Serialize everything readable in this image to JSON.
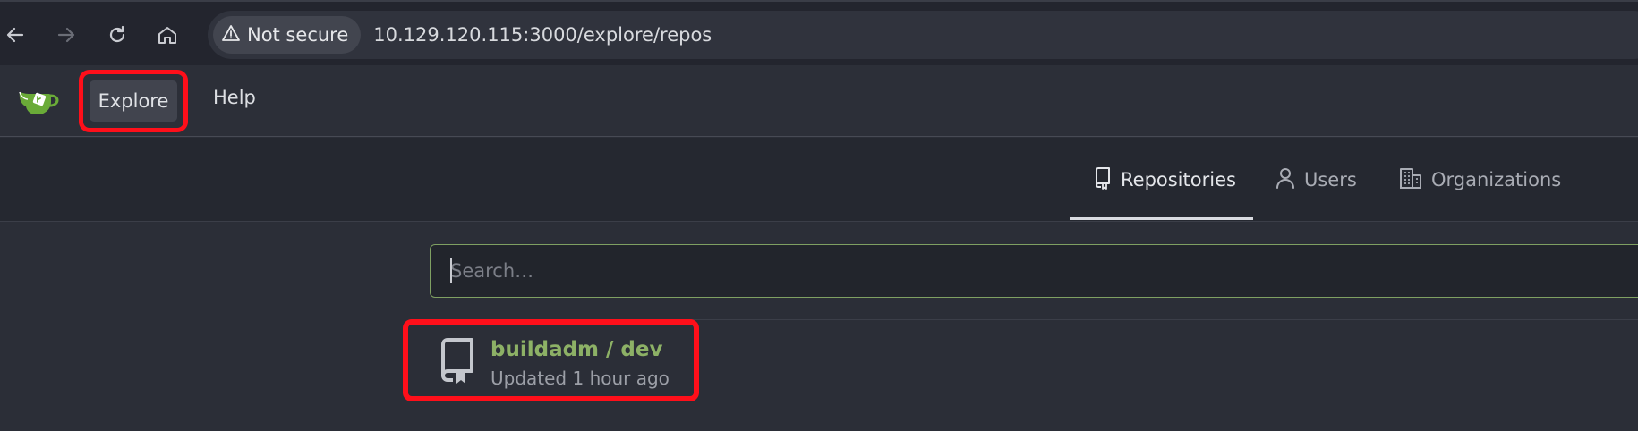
{
  "browser": {
    "security_label": "Not secure",
    "url": "10.129.120.115:3000/explore/repos"
  },
  "nav": {
    "explore_label": "Explore",
    "help_label": "Help"
  },
  "tabs": [
    {
      "label": "Repositories",
      "icon": "repo-icon",
      "active": true
    },
    {
      "label": "Users",
      "icon": "person-icon",
      "active": false
    },
    {
      "label": "Organizations",
      "icon": "organization-icon",
      "active": false
    }
  ],
  "search": {
    "placeholder": "Search…",
    "value": ""
  },
  "repos": [
    {
      "name": "buildadm / dev",
      "updated": "Updated 1 hour ago"
    }
  ],
  "colors": {
    "accent_green": "#8db166",
    "highlight_red": "#ff0f1a",
    "background": "#2b2e37"
  }
}
